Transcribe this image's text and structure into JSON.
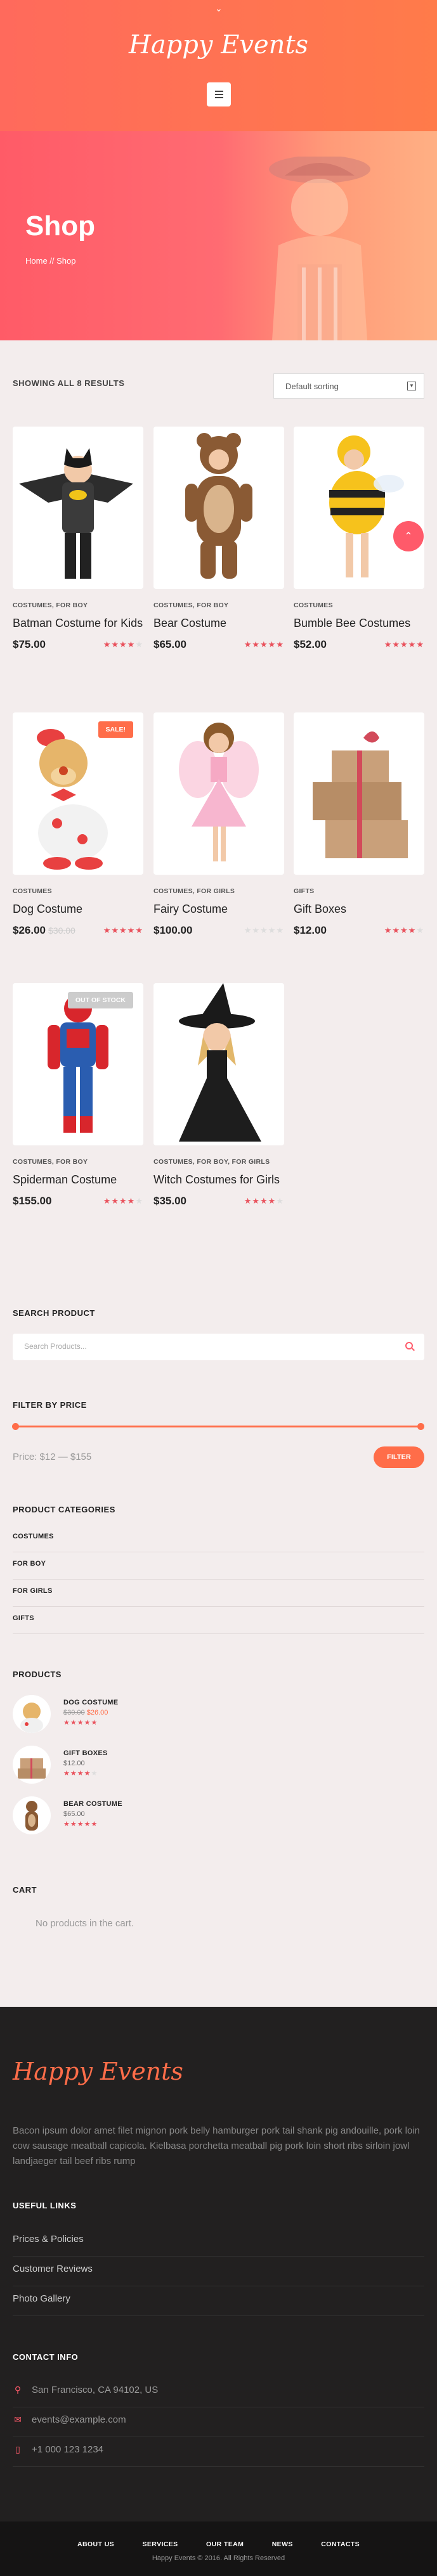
{
  "header": {
    "logo": "Happy Events",
    "menu_icon": "hamburger-icon",
    "top_icon": "chevron-down-icon"
  },
  "hero": {
    "title": "Shop",
    "breadcrumb": "Home // Shop"
  },
  "shop": {
    "results_text": "SHOWING ALL 8 RESULTS",
    "sort_value": "Default sorting",
    "products": [
      {
        "category": "COSTUMES, FOR BOY",
        "title": "Batman Costume for Kids",
        "price": "$75.00",
        "old_price": "",
        "rating": 4,
        "badge": ""
      },
      {
        "category": "COSTUMES, FOR BOY",
        "title": "Bear Costume",
        "price": "$65.00",
        "old_price": "",
        "rating": 5,
        "badge": ""
      },
      {
        "category": "COSTUMES",
        "title": "Bumble Bee Costumes",
        "price": "$52.00",
        "old_price": "",
        "rating": 5,
        "badge": ""
      },
      {
        "category": "COSTUMES",
        "title": "Dog Costume",
        "price": "$26.00",
        "old_price": "$30.00",
        "rating": 5,
        "badge": "SALE!"
      },
      {
        "category": "COSTUMES, FOR GIRLS",
        "title": "Fairy Costume",
        "price": "$100.00",
        "old_price": "",
        "rating": 0,
        "badge": ""
      },
      {
        "category": "GIFTS",
        "title": "Gift Boxes",
        "price": "$12.00",
        "old_price": "",
        "rating": 4,
        "badge": ""
      },
      {
        "category": "COSTUMES, FOR BOY",
        "title": "Spiderman Costume",
        "price": "$155.00",
        "old_price": "",
        "rating": 4,
        "badge": "OUT OF STOCK"
      },
      {
        "category": "COSTUMES, FOR BOY, FOR GIRLS",
        "title": "Witch Costumes for Girls",
        "price": "$35.00",
        "old_price": "",
        "rating": 4,
        "badge": ""
      }
    ]
  },
  "sidebar": {
    "search_title": "SEARCH PRODUCT",
    "search_placeholder": "Search Products...",
    "price_title": "FILTER BY PRICE",
    "price_range": "Price: $12 — $155",
    "filter_label": "FILTER",
    "categories_title": "PRODUCT CATEGORIES",
    "categories": [
      "COSTUMES",
      "FOR BOY",
      "FOR GIRLS",
      "GIFTS"
    ],
    "products_title": "PRODUCTS",
    "mini_products": [
      {
        "name": "DOG COSTUME",
        "old_price": "$30.00",
        "price": "$26.00",
        "rating": 5
      },
      {
        "name": "GIFT BOXES",
        "old_price": "",
        "price": "$12.00",
        "rating": 4
      },
      {
        "name": "BEAR COSTUME",
        "old_price": "",
        "price": "$65.00",
        "rating": 5
      }
    ],
    "cart_title": "CART",
    "cart_empty": "No products in the cart."
  },
  "footer": {
    "logo": "Happy Events",
    "about": "Bacon ipsum dolor amet filet mignon pork belly hamburger pork tail shank pig andouille, pork loin cow sausage meatball capicola. Kielbasa porchetta meatball pig pork loin short ribs sirloin jowl landjaeger tail beef ribs rump",
    "links_title": "USEFUL LINKS",
    "links": [
      "Prices & Policies",
      "Customer Reviews",
      "Photo Gallery"
    ],
    "contact_title": "CONTACT INFO",
    "contact": [
      {
        "icon": "location-pin-icon",
        "text": "San Francisco, CA 94102, US"
      },
      {
        "icon": "envelope-icon",
        "text": "events@example.com"
      },
      {
        "icon": "phone-icon",
        "text": "+1 000 123 1234"
      }
    ],
    "nav": [
      "ABOUT US",
      "SERVICES",
      "OUR TEAM",
      "NEWS",
      "CONTACTS"
    ],
    "copyright": "Happy Events © 2016. All Rights Reserved"
  },
  "colors": {
    "accent": "#ff6d49",
    "pink": "#ff5a6a",
    "star": "#e9515c",
    "dark": "#222020"
  }
}
